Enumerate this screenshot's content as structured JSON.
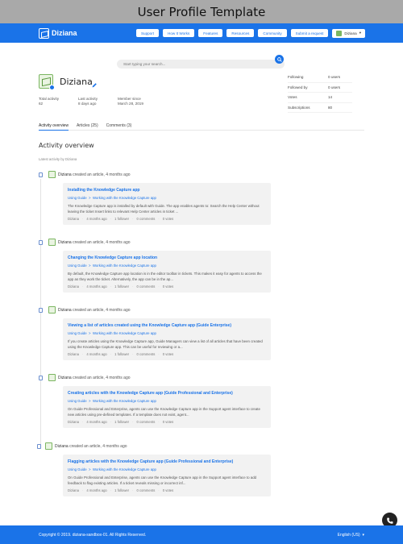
{
  "page_title": "User Profile Template",
  "brand": {
    "name": "Diziana"
  },
  "nav": [
    {
      "label": "Support"
    },
    {
      "label": "How It Works"
    },
    {
      "label": "Features"
    },
    {
      "label": "Resources"
    },
    {
      "label": "Community"
    },
    {
      "label": "Submit a request"
    }
  ],
  "user_menu": {
    "label": "Diziana"
  },
  "search": {
    "placeholder": "Start typing your search..."
  },
  "profile": {
    "name": "Diziana",
    "stats": [
      {
        "label": "Total activity",
        "value": "62"
      },
      {
        "label": "Last activity",
        "value": "8 days ago"
      },
      {
        "label": "Member since",
        "value": "March 28, 2019"
      }
    ]
  },
  "side_stats": [
    {
      "label": "Following",
      "value": "0 users"
    },
    {
      "label": "Followed by",
      "value": "0 users"
    },
    {
      "label": "Votes",
      "value": "14"
    },
    {
      "label": "Subscriptions",
      "value": "80"
    }
  ],
  "tabs": [
    {
      "label": "Activity overview"
    },
    {
      "label": "Articles (25)"
    },
    {
      "label": "Comments (3)"
    }
  ],
  "section": {
    "title": "Activity overview",
    "subtitle": "Latest activity by Diziana"
  },
  "activities": [
    {
      "author": "Diziana",
      "action": "created an article, 4 months ago",
      "title": "Installing the Knowledge Capture app",
      "crumb1": "Using Guide",
      "crumb_sep": ">",
      "crumb2": "Working with the Knowledge Capture app",
      "body": "The Knowledge Capture app is installed by default with Guide. The app enables agents to: Search the Help Center without leaving the ticket Insert links to relevant Help Center articles in ticket ...",
      "meta": [
        "Diziana",
        "4 months ago",
        "1 follower",
        "0 comments",
        "0 votes"
      ]
    },
    {
      "author": "Diziana",
      "action": "created an article, 4 months ago",
      "title": "Changing the Knowledge Capture app location",
      "crumb1": "Using Guide",
      "crumb_sep": ">",
      "crumb2": "Working with the Knowledge Capture app",
      "body": "By default, the Knowledge Capture app location is in the editor toolbar in tickets. This makes it easy for agents to access the app as they work the ticket. Alternatively, the app can be in the ap...",
      "meta": [
        "Diziana",
        "4 months ago",
        "1 follower",
        "0 comments",
        "0 votes"
      ]
    },
    {
      "author": "Diziana",
      "action": "created an article, 4 months ago",
      "title": "Viewing a list of articles created using the Knowledge Capture app (Guide Enterprise)",
      "crumb1": "Using Guide",
      "crumb_sep": ">",
      "crumb2": "Working with the Knowledge Capture app",
      "body": "If you create articles using the Knowledge Capture app, Guide Managers can view a list of all articles that have been created using the Knowledge Capture app. This can be useful for reviewing or a...",
      "meta": [
        "Diziana",
        "4 months ago",
        "1 follower",
        "0 comments",
        "0 votes"
      ]
    },
    {
      "author": "Diziana",
      "action": "created an article, 4 months ago",
      "title": "Creating articles with the Knowledge Capture app (Guide Professional and Enterprise)",
      "crumb1": "Using Guide",
      "crumb_sep": ">",
      "crumb2": "Working with the Knowledge Capture app",
      "body": "On Guide Professional and Enterprise, agents can use the Knowledge Capture app in the Support agent interface to create new articles using pre-defined templates. If a template does not exist, agent...",
      "meta": [
        "Diziana",
        "4 months ago",
        "1 follower",
        "0 comments",
        "0 votes"
      ]
    },
    {
      "author": "Diziana",
      "action": "created an article, 4 months ago",
      "title": "Flagging articles with the Knowledge Capture app (Guide Professional and Enterprise)",
      "crumb1": "Using Guide",
      "crumb_sep": ">",
      "crumb2": "Working with the Knowledge Capture app",
      "body": "On Guide Professional and Enterprise, agents can use the Knowledge Capture app in the Support agent interface to add feedback to flag existing articles. If a ticket reveals missing or incorrect inf...",
      "meta": [
        "Diziana",
        "4 months ago",
        "1 follower",
        "0 comments",
        "0 votes"
      ]
    }
  ],
  "footer": {
    "copyright": "Copyright © 2019. diziana-sandbox-01. All Rights Reserved.",
    "language": "English (US)"
  },
  "colors": {
    "brand": "#1a73e8",
    "avatar_green": "#7bb661"
  }
}
